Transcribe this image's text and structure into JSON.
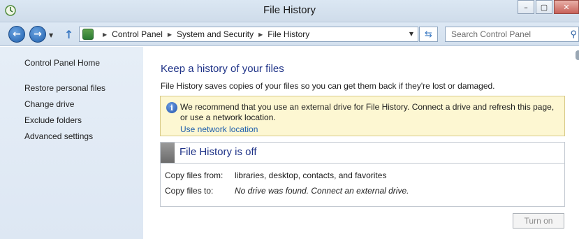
{
  "window": {
    "title": "File History",
    "minimize_glyph": "–",
    "maximize_glyph": "▢",
    "close_glyph": "✕"
  },
  "nav": {
    "back_glyph": "←",
    "forward_glyph": "→",
    "up_glyph": "↑",
    "breadcrumbs": [
      "Control Panel",
      "System and Security",
      "File History"
    ],
    "search_placeholder": "Search Control Panel"
  },
  "sidebar": {
    "home": "Control Panel Home",
    "items": [
      "Restore personal files",
      "Change drive",
      "Exclude folders",
      "Advanced settings"
    ]
  },
  "main": {
    "heading": "Keep a history of your files",
    "description": "File History saves copies of your files so you can get them back if they're lost or damaged.",
    "info": {
      "text": "We recommend that you use an external drive for File History. Connect a drive and refresh this page, or use a network location.",
      "link": "Use network location"
    },
    "status": {
      "title": "File History is off",
      "copy_from_label": "Copy files from:",
      "copy_from_value": "libraries, desktop, contacts, and favorites",
      "copy_to_label": "Copy files to:",
      "copy_to_value": "No drive was found. Connect an external drive."
    },
    "turn_on": "Turn on"
  },
  "colors": {
    "heading": "#1e3287",
    "link": "#1f5fad",
    "info_background": "#fdf7d2",
    "sidebar_background": "#e6eef7"
  }
}
